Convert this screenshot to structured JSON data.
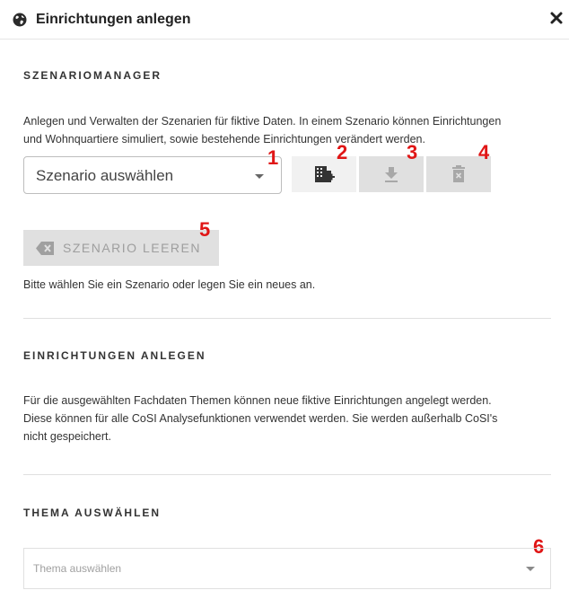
{
  "header": {
    "title": "Einrichtungen anlegen",
    "icon": "globe-icon",
    "close_icon": "close-icon"
  },
  "scenario_manager": {
    "heading": "SZENARIOMANAGER",
    "description_line1": "Anlegen und Verwalten der Szenarien für fiktive Daten. In einem Szenario können Einrichtungen",
    "description_line2": "und Wohnquartiere simuliert, sowie bestehende Einrichtungen verändert werden.",
    "select_value": "Szenario auswählen",
    "markers": [
      "1",
      "2",
      "3",
      "4",
      "5"
    ],
    "clear_button_label": "SZENARIO LEEREN",
    "hint": "Bitte wählen Sie ein Szenario oder legen Sie ein neues an."
  },
  "facilities": {
    "heading": "EINRICHTUNGEN ANLEGEN",
    "line1": "Für die ausgewählten Fachdaten Themen können neue fiktive Einrichtungen angelegt werden.",
    "line2": "Diese können für alle CoSI Analysefunktionen verwendet werden. Sie werden außerhalb CoSI's",
    "line3": "nicht gespeichert."
  },
  "theme": {
    "heading": "THEMA AUSWÄHLEN",
    "placeholder": "Thema auswählen",
    "marker": "6"
  },
  "colors": {
    "marker": "#e01616",
    "disabled_bg": "#e0e0e0",
    "enabled_bg": "#f1f1f1"
  }
}
